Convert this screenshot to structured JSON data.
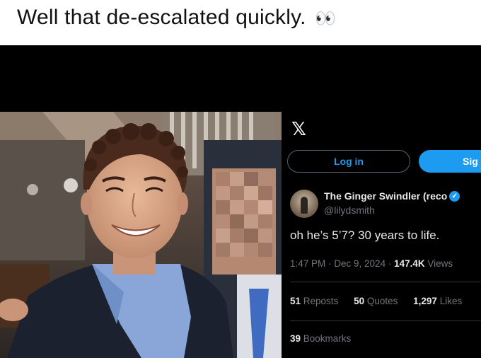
{
  "caption": {
    "text": "Well that de-escalated quickly.",
    "emoji": "👀"
  },
  "photo": {
    "description_icon": "photo-of-two-people"
  },
  "tweet": {
    "logo": "𝕏",
    "login_label": "Log in",
    "signup_label": "Sig",
    "author_name": "The Ginger Swindler (reco",
    "handle": "@lilydsmith",
    "text": "oh he’s 5’7? 30 years to life.",
    "time": "1:47 PM · Dec 9, 2024 · ",
    "views_count": "147.4K",
    "views_label": " Views",
    "reposts_count": "51",
    "reposts_label": " Reposts",
    "quotes_count": "50",
    "quotes_label": " Quotes",
    "likes_count": "1,297",
    "likes_label": " Likes",
    "bookmarks_count": "39",
    "bookmarks_label": " Bookmarks"
  },
  "colors": {
    "accent": "#1d9bf0",
    "background": "#000000",
    "muted": "#71767b"
  }
}
